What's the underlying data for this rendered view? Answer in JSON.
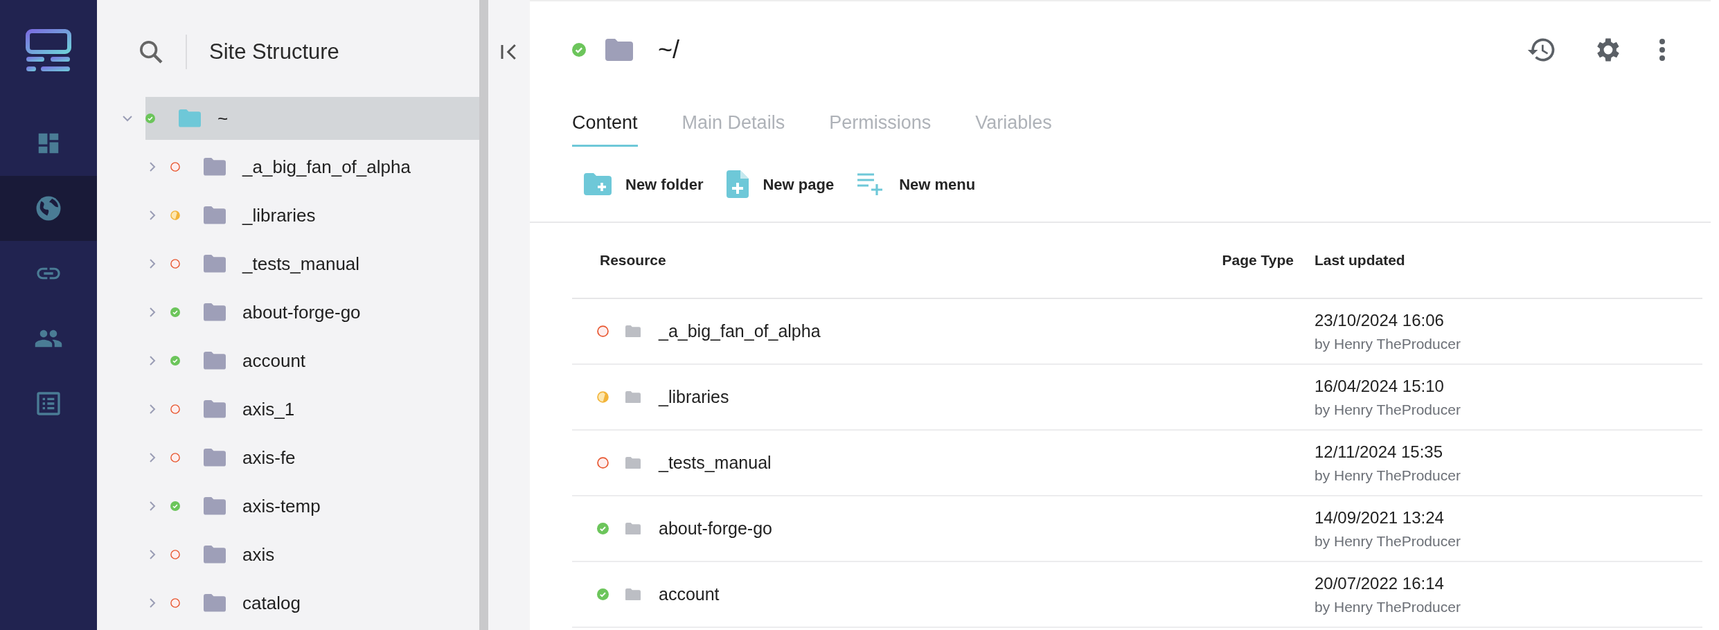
{
  "rail": {
    "items": [
      {
        "kind": "dashboard",
        "selected": false
      },
      {
        "kind": "globe",
        "selected": true
      },
      {
        "kind": "link",
        "selected": false
      },
      {
        "kind": "people",
        "selected": false
      },
      {
        "kind": "list",
        "selected": false
      }
    ]
  },
  "sidebar": {
    "title": "Site Structure",
    "tree": [
      {
        "label": "~",
        "kind": "published",
        "selected": true,
        "expanded": true,
        "children": [
          {
            "label": "_a_big_fan_of_alpha",
            "kind": "unpublished",
            "selected": false,
            "expanded": false
          },
          {
            "label": "_libraries",
            "kind": "partial",
            "selected": false,
            "expanded": false
          },
          {
            "label": "_tests_manual",
            "kind": "unpublished",
            "selected": false,
            "expanded": false
          },
          {
            "label": "about-forge-go",
            "kind": "published",
            "selected": false,
            "expanded": false
          },
          {
            "label": "account",
            "kind": "published",
            "selected": false,
            "expanded": false
          },
          {
            "label": "axis_1",
            "kind": "unpublished",
            "selected": false,
            "expanded": false
          },
          {
            "label": "axis-fe",
            "kind": "unpublished",
            "selected": false,
            "expanded": false
          },
          {
            "label": "axis-temp",
            "kind": "published",
            "selected": false,
            "expanded": false
          },
          {
            "label": "axis",
            "kind": "unpublished",
            "selected": false,
            "expanded": false
          },
          {
            "label": "catalog",
            "kind": "unpublished",
            "selected": false,
            "expanded": false
          }
        ]
      }
    ]
  },
  "header": {
    "kind": "published",
    "path": "~/"
  },
  "tabs": [
    {
      "label": "Content",
      "selected": true
    },
    {
      "label": "Main Details",
      "selected": false
    },
    {
      "label": "Permissions",
      "selected": false
    },
    {
      "label": "Variables",
      "selected": false
    }
  ],
  "actions": [
    {
      "kind": "folder",
      "label": "New folder"
    },
    {
      "kind": "page",
      "label": "New page"
    },
    {
      "kind": "menu",
      "label": "New menu"
    }
  ],
  "table": {
    "columns": [
      "Resource",
      "Page Type",
      "Last updated"
    ],
    "rows": [
      {
        "kind": "unpublished",
        "name": "_a_big_fan_of_alpha",
        "date": "23/10/2024 16:06",
        "by": "by Henry TheProducer"
      },
      {
        "kind": "partial",
        "name": "_libraries",
        "date": "16/04/2024 15:10",
        "by": "by Henry TheProducer"
      },
      {
        "kind": "unpublished",
        "name": "_tests_manual",
        "date": "12/11/2024 15:35",
        "by": "by Henry TheProducer"
      },
      {
        "kind": "published",
        "name": "about-forge-go",
        "date": "14/09/2021 13:24",
        "by": "by Henry TheProducer"
      },
      {
        "kind": "published",
        "name": "account",
        "date": "20/07/2022 16:14",
        "by": "by Henry TheProducer"
      }
    ]
  }
}
